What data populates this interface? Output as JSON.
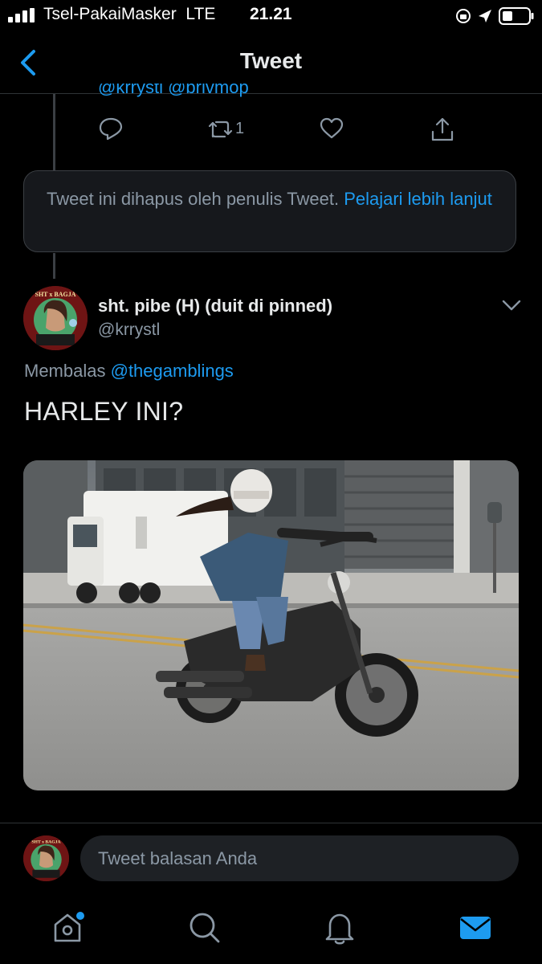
{
  "status_bar": {
    "carrier": "Tsel-PakaiMasker",
    "network": "LTE",
    "time": "21.21"
  },
  "header": {
    "title": "Tweet",
    "back_icon": "chevron-left-icon"
  },
  "previous_tweet": {
    "mentions": "@krrystl @brlvmop",
    "actions": {
      "reply_icon": "comment-icon",
      "retweet_icon": "retweet-icon",
      "retweet_count": "1",
      "like_icon": "heart-icon",
      "share_icon": "share-icon"
    }
  },
  "deleted_notice": {
    "text": "Tweet ini dihapus oleh penulis Tweet.",
    "link": "Pelajari lebih lanjut"
  },
  "tweet": {
    "author_name": "sht. pibe (H) (duit di pinned)",
    "author_handle": "@krrystl",
    "avatar_caption": "SHT x BAGJA",
    "reply_prefix": "Membalas",
    "reply_mention": "@thegamblings",
    "text": "HARLEY INI?",
    "media_description": "photo"
  },
  "composer": {
    "placeholder": "Tweet balasan Anda"
  },
  "tab_bar": {
    "items": [
      {
        "icon": "home-icon",
        "has_dot": true
      },
      {
        "icon": "search-icon"
      },
      {
        "icon": "bell-icon"
      },
      {
        "icon": "mail-icon",
        "active": true
      }
    ]
  },
  "colors": {
    "accent": "#1d9bf0",
    "background": "#000000",
    "muted": "#8b98a5"
  }
}
